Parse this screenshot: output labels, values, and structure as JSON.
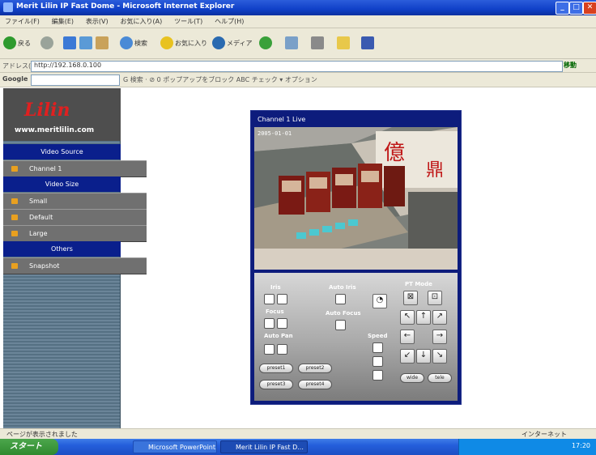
{
  "window": {
    "title": "Merit Lilin IP Fast Dome - Microsoft Internet Explorer"
  },
  "menubar": [
    "ファイル(F)",
    "編集(E)",
    "表示(V)",
    "お気に入り(A)",
    "ツール(T)",
    "ヘルプ(H)"
  ],
  "toolbar": {
    "back_label": "戻る",
    "search_label": "検索",
    "favorites_label": "お気に入り",
    "media_label": "メディア"
  },
  "address_bar": {
    "label": "アドレス(D)",
    "url": "http://192.168.0.100",
    "go_label": "移動"
  },
  "google_bar": {
    "label": "Google",
    "options": "G 検索 · ⊘ 0 ポップアップをブロック  ABC チェック  ▾ オプション"
  },
  "sidebar": {
    "brand": "Lilin",
    "site": "www.meritlilin.com",
    "items": [
      {
        "label": "Video Source",
        "kind": "section"
      },
      {
        "label": "Channel 1",
        "kind": "item"
      },
      {
        "label": "Video Size",
        "kind": "section"
      },
      {
        "label": "Small",
        "kind": "item"
      },
      {
        "label": "Default",
        "kind": "item"
      },
      {
        "label": "Large",
        "kind": "item"
      },
      {
        "label": "Others",
        "kind": "section"
      },
      {
        "label": "Snapshot",
        "kind": "item"
      }
    ]
  },
  "viewer": {
    "channel_title": "Channel 1 Live",
    "timestamp": "2005-01-01",
    "ptz": {
      "iris_label": "Iris",
      "focus_label": "Focus",
      "auto_pan_label": "Auto Pan",
      "auto_iris_label": "Auto Iris",
      "auto_focus_label": "Auto Focus",
      "speed_label": "Speed",
      "zoom_label": "PT Mode",
      "preset_buttons": [
        "preset1",
        "preset2",
        "preset3",
        "preset4"
      ],
      "bottom_buttons": [
        "wide",
        "tele"
      ]
    }
  },
  "statusbar": {
    "status_text": "ページが表示されました",
    "zone": "インターネット"
  },
  "taskbar": {
    "start_label": "スタート",
    "tasks": [
      "Microsoft PowerPoint...",
      "Merit Lilin IP Fast D..."
    ],
    "clock": "17:20"
  }
}
